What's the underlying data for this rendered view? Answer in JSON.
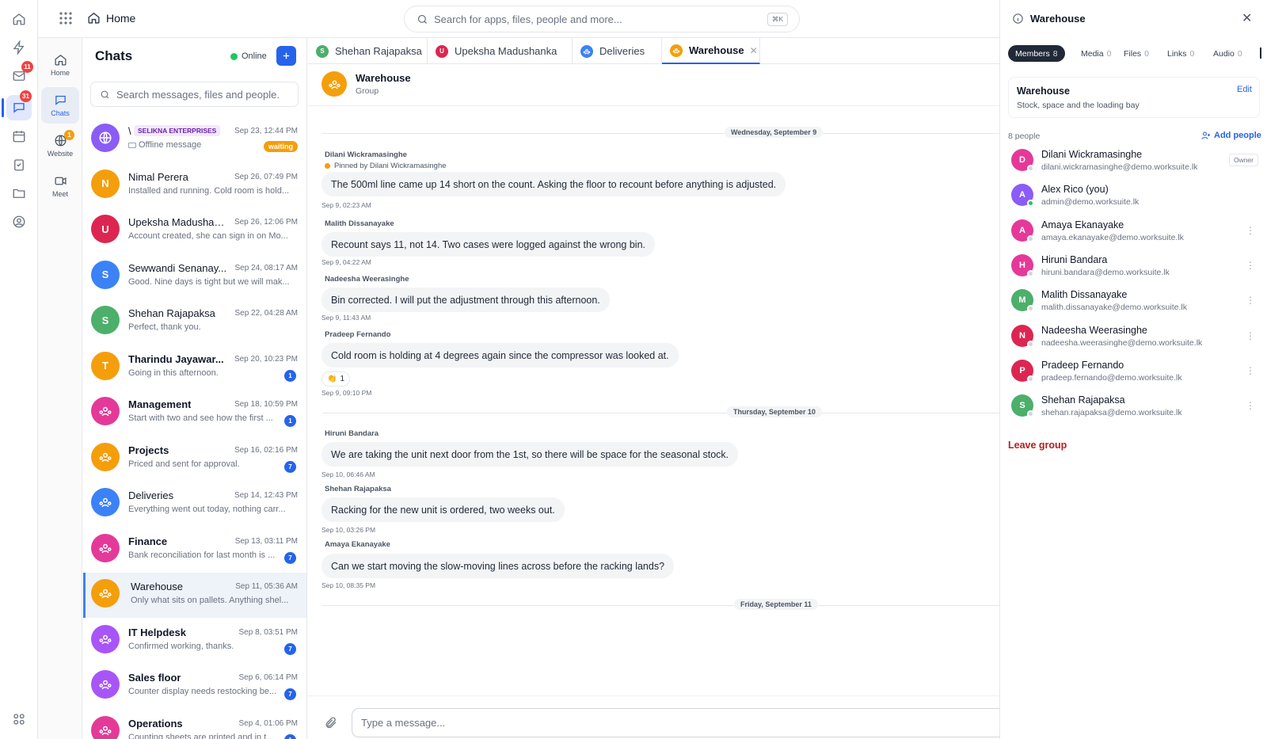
{
  "rail": {
    "mail_badge": "11",
    "chat_badge": "31"
  },
  "topbar": {
    "home_label": "Home",
    "search_placeholder": "Search for apps, files, people and more...",
    "shortcut": "⌘K"
  },
  "modules": [
    {
      "label": "Home",
      "badge": ""
    },
    {
      "label": "Chats",
      "badge": ""
    },
    {
      "label": "Website",
      "badge": "1"
    },
    {
      "label": "Meet",
      "badge": ""
    }
  ],
  "chatlist": {
    "title": "Chats",
    "status": "Online",
    "search_placeholder": "Search messages, files and people.",
    "items": [
      {
        "name": "\\",
        "tag": "SELIKNA ENTERPRISES",
        "date": "Sep 23, 12:44 PM",
        "preview": "Offline message",
        "status_pill": "waiting",
        "badge": "",
        "initial": "",
        "color": "#8b5cf6",
        "bold": false
      },
      {
        "name": "Nimal Perera",
        "date": "Sep 26, 07:49 PM",
        "preview": "Installed and running. Cold room is hold...",
        "badge": "",
        "initial": "N",
        "color": "#f59e0b",
        "bold": false
      },
      {
        "name": "Upeksha Madushan...",
        "date": "Sep 26, 12:06 PM",
        "preview": "Account created, she can sign in on Mo...",
        "badge": "",
        "initial": "U",
        "color": "#dc2651",
        "bold": false
      },
      {
        "name": "Sewwandi Senanay...",
        "date": "Sep 24, 08:17 AM",
        "preview": "Good. Nine days is tight but we will mak...",
        "badge": "",
        "initial": "S",
        "color": "#3b82f6",
        "bold": false
      },
      {
        "name": "Shehan Rajapaksa",
        "date": "Sep 22, 04:28 AM",
        "preview": "Perfect, thank you.",
        "badge": "",
        "initial": "S",
        "color": "#4caf6a",
        "bold": false
      },
      {
        "name": "Tharindu Jayawar...",
        "date": "Sep 20, 10:23 PM",
        "preview": "Going in this afternoon.",
        "badge": "1",
        "initial": "T",
        "color": "#f59e0b",
        "bold": true
      },
      {
        "name": "Management",
        "date": "Sep 18, 10:59 PM",
        "preview": "Start with two and see how the first ...",
        "badge": "1",
        "initial": "",
        "color": "#e5399a",
        "bold": true
      },
      {
        "name": "Projects",
        "date": "Sep 16, 02:16 PM",
        "preview": "Priced and sent for approval.",
        "badge": "7",
        "initial": "",
        "color": "#f59e0b",
        "bold": true
      },
      {
        "name": "Deliveries",
        "date": "Sep 14, 12:43 PM",
        "preview": "Everything went out today, nothing carr...",
        "badge": "",
        "initial": "",
        "color": "#3b82f6",
        "bold": false
      },
      {
        "name": "Finance",
        "date": "Sep 13, 03:11 PM",
        "preview": "Bank reconciliation for last month is ...",
        "badge": "7",
        "initial": "",
        "color": "#e5399a",
        "bold": true
      },
      {
        "name": "Warehouse",
        "date": "Sep 11, 05:36 AM",
        "preview": "Only what sits on pallets. Anything shel...",
        "badge": "",
        "initial": "",
        "color": "#f59e0b",
        "bold": false,
        "active": true
      },
      {
        "name": "IT Helpdesk",
        "date": "Sep 8, 03:51 PM",
        "preview": "Confirmed working, thanks.",
        "badge": "7",
        "initial": "",
        "color": "#a855f7",
        "bold": true
      },
      {
        "name": "Sales floor",
        "date": "Sep 6, 06:14 PM",
        "preview": "Counter display needs restocking be...",
        "badge": "7",
        "initial": "",
        "color": "#a855f7",
        "bold": true
      },
      {
        "name": "Operations",
        "date": "Sep 4, 01:06 PM",
        "preview": "Counting sheets are printed and in t...",
        "badge": "1",
        "initial": "",
        "color": "#e5399a",
        "bold": true
      }
    ]
  },
  "tabs": [
    {
      "label": "Shehan Rajapaksa",
      "initial": "S",
      "color": "#4caf6a"
    },
    {
      "label": "Upeksha Madushanka",
      "initial": "U",
      "color": "#dc2651"
    },
    {
      "label": "Deliveries",
      "initial": "",
      "color": "#3b82f6"
    },
    {
      "label": "Warehouse",
      "initial": "",
      "color": "#f59e0b",
      "active": true
    }
  ],
  "conversation": {
    "title": "Warehouse",
    "subtitle": "Group",
    "days": [
      "Wednesday, September 9",
      "Thursday, September 10",
      "Friday, September 11"
    ],
    "pinned_note": "Pinned by Dilani Wickramasinghe",
    "messages": [
      {
        "sender": "Dilani Wickramasinghe",
        "text": "The 500ml line came up 14 short on the count. Asking the floor to recount before anything is adjusted.",
        "time": "Sep 9, 02:23 AM"
      },
      {
        "sender": "Malith Dissanayake",
        "text": "Recount says 11, not 14. Two cases were logged against the wrong bin.",
        "time": "Sep 9, 04:22 AM"
      },
      {
        "sender": "Nadeesha Weerasinghe",
        "text": "Bin corrected. I will put the adjustment through this afternoon.",
        "time": "Sep 9, 11:43 AM"
      },
      {
        "sender": "Pradeep Fernando",
        "text": "Cold room is holding at 4 degrees again since the compressor was looked at.",
        "time": "Sep 9, 09:10 PM",
        "reaction": "👏",
        "reaction_count": "1"
      },
      {
        "sender": "Hiruni Bandara",
        "text": "We are taking the unit next door from the 1st, so there will be space for the seasonal stock.",
        "time": "Sep 10, 06:46 AM"
      },
      {
        "sender": "Shehan Rajapaksa",
        "text": "Racking for the new unit is ordered, two weeks out.",
        "time": "Sep 10, 03:26 PM"
      },
      {
        "sender": "Amaya Ekanayake",
        "text": "Can we start moving the slow-moving lines across before the racking lands?",
        "time": "Sep 10, 08:35 PM"
      }
    ],
    "composer_placeholder": "Type a message..."
  },
  "panel": {
    "title": "Warehouse",
    "tabs": [
      {
        "label": "Members",
        "count": "8",
        "active": true
      },
      {
        "label": "Media",
        "count": "0"
      },
      {
        "label": "Files",
        "count": "0"
      },
      {
        "label": "Links",
        "count": "0"
      },
      {
        "label": "Audio",
        "count": "0"
      }
    ],
    "group_name": "Warehouse",
    "group_desc": "Stock, space and the loading bay",
    "edit_label": "Edit",
    "people_count": "8 people",
    "add_people": "Add people",
    "members": [
      {
        "name": "Dilani Wickramasinghe",
        "email": "dilani.wickramasinghe@demo.worksuite.lk",
        "initial": "D",
        "color": "#e5399a",
        "role": "Owner",
        "online": false
      },
      {
        "name": "Alex Rico (you)",
        "email": "admin@demo.worksuite.lk",
        "initial": "A",
        "color": "#8b5cf6",
        "role": "",
        "online": true
      },
      {
        "name": "Amaya Ekanayake",
        "email": "amaya.ekanayake@demo.worksuite.lk",
        "initial": "A",
        "color": "#e5399a",
        "role": "",
        "online": false
      },
      {
        "name": "Hiruni Bandara",
        "email": "hiruni.bandara@demo.worksuite.lk",
        "initial": "H",
        "color": "#e5399a",
        "role": "",
        "online": false
      },
      {
        "name": "Malith Dissanayake",
        "email": "malith.dissanayake@demo.worksuite.lk",
        "initial": "M",
        "color": "#4caf6a",
        "role": "",
        "online": false
      },
      {
        "name": "Nadeesha Weerasinghe",
        "email": "nadeesha.weerasinghe@demo.worksuite.lk",
        "initial": "N",
        "color": "#dc2651",
        "role": "",
        "online": false
      },
      {
        "name": "Pradeep Fernando",
        "email": "pradeep.fernando@demo.worksuite.lk",
        "initial": "P",
        "color": "#dc2651",
        "role": "",
        "online": false
      },
      {
        "name": "Shehan Rajapaksa",
        "email": "shehan.rajapaksa@demo.worksuite.lk",
        "initial": "S",
        "color": "#4caf6a",
        "role": "",
        "online": false
      }
    ],
    "leave_group": "Leave group"
  },
  "colors": {
    "accent": "#2563eb",
    "danger": "#b91c1c",
    "waiting": "#f59e0b"
  }
}
